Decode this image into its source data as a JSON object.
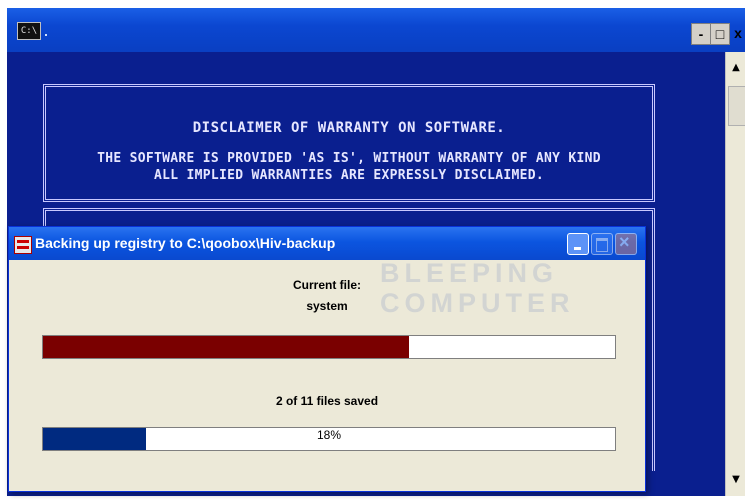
{
  "console": {
    "icon_label": "C:\\",
    "controls": {
      "minimize": "-",
      "maximize": "□",
      "close": "x"
    },
    "disclaimer_title": "DISCLAIMER OF WARRANTY ON SOFTWARE.",
    "disclaimer_lines": [
      "THE SOFTWARE IS PROVIDED 'AS IS', WITHOUT WARRANTY OF ANY KIND",
      "ALL IMPLIED WARRANTIES ARE EXPRESSLY DISCLAIMED."
    ]
  },
  "dialog": {
    "title": "Backing up registry to C:\\qoobox\\Hiv-backup",
    "current_file_label": "Current file:",
    "current_file": "system",
    "file_progress_fraction": 0.64,
    "files_saved_text": "2 of 11 files saved",
    "overall_progress_percent": 18,
    "overall_progress_text": "18%"
  },
  "watermark": {
    "line1": "BLEEPING",
    "line2": "COMPUTER"
  },
  "colors": {
    "console_bg": "#0a1f8f",
    "file_bar": "#7a0000",
    "overall_bar": "#002a80",
    "dialog_bg": "#ece9d8"
  }
}
